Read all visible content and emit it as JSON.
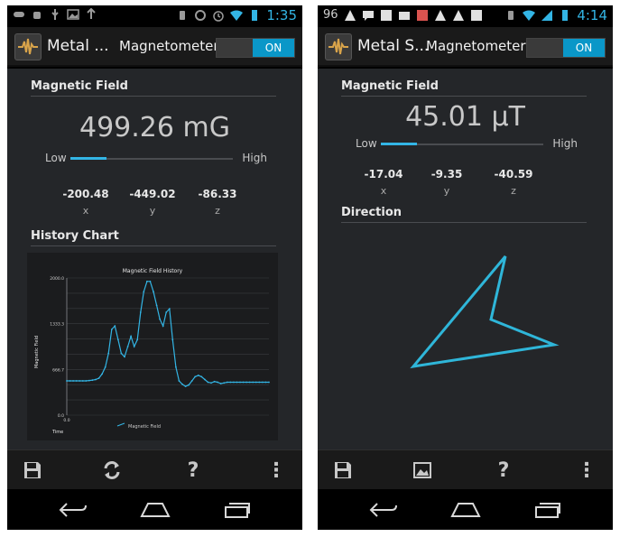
{
  "left": {
    "status": {
      "time": "1:35"
    },
    "appbar": {
      "title": "Metal ...",
      "subtitle": "Magnetometer",
      "toggle": "ON"
    },
    "field": {
      "section_title": "Magnetic Field",
      "value": "499.26 mG",
      "low_label": "Low",
      "high_label": "High",
      "level": 0.22,
      "x_value": "-200.48",
      "y_value": "-449.02",
      "z_value": "-86.33",
      "x_label": "x",
      "y_label": "y",
      "z_label": "z"
    },
    "history_title": "History Chart",
    "toolbar": {
      "help": "?",
      "menu": "⋮"
    },
    "accent": "#33b5e5"
  },
  "right": {
    "status": {
      "battery_text": "96",
      "time": "4:14"
    },
    "appbar": {
      "title": "Metal S...",
      "subtitle": "Magnetometer",
      "toggle": "ON"
    },
    "field": {
      "section_title": "Magnetic Field",
      "value": "45.01 µT",
      "low_label": "Low",
      "high_label": "High",
      "level": 0.22,
      "x_value": "-17.04",
      "y_value": "-9.35",
      "z_value": "-40.59",
      "x_label": "x",
      "y_label": "y",
      "z_label": "z"
    },
    "direction_title": "Direction",
    "toolbar": {
      "help": "?",
      "menu": "⋮"
    }
  },
  "chart_data": {
    "type": "line",
    "title": "Magnetic Field History",
    "xlabel": "Time",
    "ylabel": "Magnetic Field",
    "y_ticks": [
      "0.0",
      "666.7",
      "1333.3",
      "2000.0"
    ],
    "x_ticks": [
      "0.0"
    ],
    "ylim": [
      0,
      2000
    ],
    "series": [
      {
        "name": "Magnetic Field",
        "y": [
          500,
          500,
          500,
          500,
          500,
          500,
          500,
          505,
          510,
          520,
          540,
          600,
          700,
          900,
          1250,
          1300,
          1100,
          900,
          850,
          1000,
          1150,
          1000,
          1100,
          1500,
          1800,
          1950,
          1950,
          1800,
          1600,
          1400,
          1300,
          1500,
          1550,
          1100,
          700,
          500,
          450,
          420,
          440,
          500,
          560,
          580,
          560,
          520,
          480,
          470,
          490,
          480,
          460,
          470,
          480,
          480,
          480,
          480,
          480,
          480,
          480,
          480,
          480,
          480,
          480,
          480,
          480,
          480
        ]
      }
    ],
    "legend": "bottom",
    "grid": true
  }
}
